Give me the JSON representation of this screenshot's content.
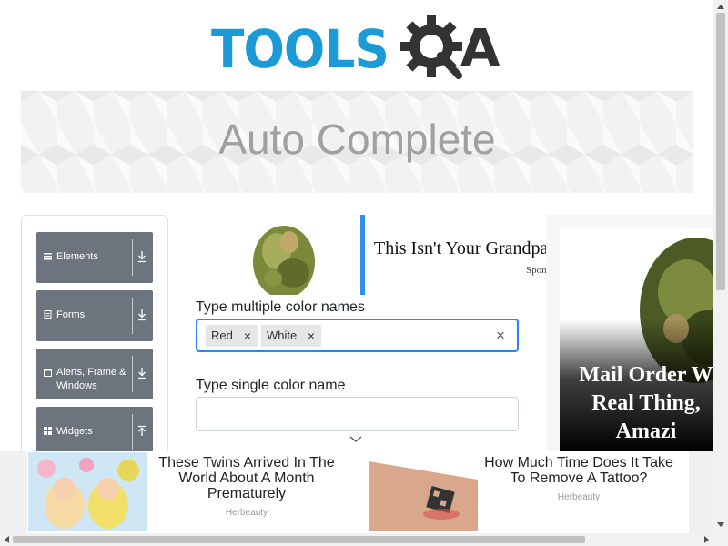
{
  "header": {
    "logo_text": "TOOLS",
    "logo_suffix": "A",
    "logo_alt": "TOOLSQA"
  },
  "banner": {
    "title": "Auto Complete"
  },
  "sidebar": {
    "items": [
      {
        "label": "Elements",
        "icon": "list-icon",
        "arrow": "download-arrow-icon"
      },
      {
        "label": "Forms",
        "icon": "form-icon",
        "arrow": "download-arrow-icon"
      },
      {
        "label": "Alerts, Frame &\nWindows",
        "icon": "window-icon",
        "arrow": "download-arrow-icon"
      },
      {
        "label": "Widgets",
        "icon": "widgets-grid-icon",
        "arrow": "upload-arrow-icon"
      }
    ]
  },
  "form": {
    "multi_label": "Type multiple color names",
    "multi_values": [
      "Red",
      "White"
    ],
    "chip_remove": "×",
    "clear_all": "×",
    "single_label": "Type single color name",
    "single_value": ""
  },
  "ads": {
    "top": {
      "title": "This Isn't Your Grandpa",
      "sponsor": "Spon"
    },
    "right": {
      "text": "Mail Order W\nReal Thing,\nAmazi"
    },
    "bottom": [
      {
        "title": "These Twins Arrived In The World About A Month Prematurely",
        "source": "Herbeauty"
      },
      {
        "title": "How Much Time Does It Take To Remove A Tattoo?",
        "source": "Herbeauty"
      }
    ]
  },
  "colors": {
    "brand_blue": "#1a9bd7",
    "menu_gray": "#6c757d",
    "focus_blue": "#2684ff",
    "ad_accent": "#2f8fe8"
  }
}
